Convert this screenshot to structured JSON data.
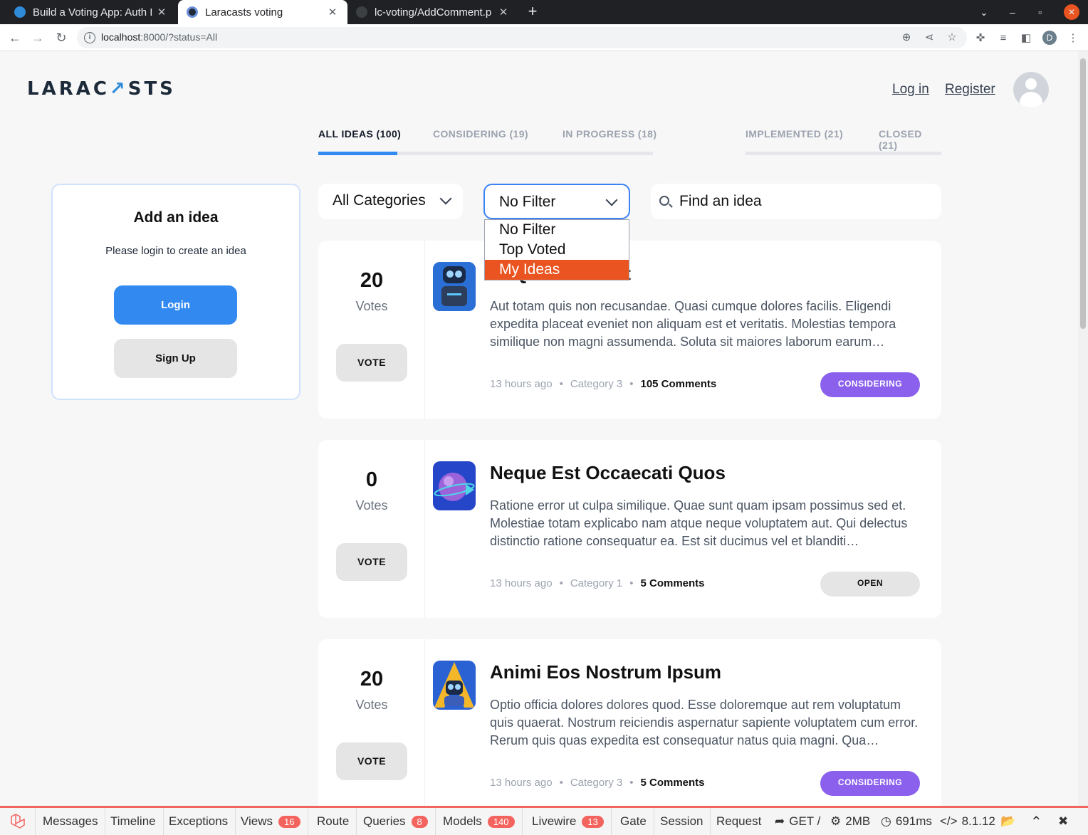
{
  "browser": {
    "tabs": [
      {
        "title": "Build a Voting App: Auth I",
        "active": false
      },
      {
        "title": "Laracasts voting",
        "active": true
      },
      {
        "title": "lc-voting/AddComment.p",
        "active": false
      }
    ],
    "new_tab": "+",
    "url_host": "localhost",
    "url_rest": ":8000/?status=All",
    "profile_initial": "D"
  },
  "header": {
    "logo_left": "LARAC",
    "logo_accent": "↗",
    "logo_right": "STS",
    "login_link": "Log in",
    "register_link": "Register"
  },
  "status_tabs": [
    {
      "label": "ALL IDEAS (100)",
      "active": true
    },
    {
      "label": "CONSIDERING (19)",
      "active": false
    },
    {
      "label": "IN PROGRESS (18)",
      "active": false
    },
    {
      "label": "IMPLEMENTED (21)",
      "active": false
    },
    {
      "label": "CLOSED (21)",
      "active": false
    }
  ],
  "sidebar": {
    "title": "Add an idea",
    "subtitle": "Please login to create an idea",
    "login_button": "Login",
    "signup_button": "Sign Up"
  },
  "filters": {
    "category": "All Categories",
    "other": "No Filter",
    "search_placeholder": "Find an idea",
    "dropdown_options": [
      "No Filter",
      "Top Voted",
      "My Ideas"
    ],
    "highlighted_option": "My Ideas"
  },
  "ideas": [
    {
      "votes": "20",
      "votes_label": "Votes",
      "vote_button": "VOTE",
      "title": "Et Quo Sunt Est",
      "description": "Aut totam quis non recusandae. Quasi cumque dolores facilis. Eligendi expedita placeat eveniet non aliquam est et veritatis. Molestias tempora similique non magni assumenda. Soluta sit maiores laborum earum…",
      "time": "13 hours ago",
      "category": "Category 3",
      "comments": "105 Comments",
      "status": "CONSIDERING",
      "icon": "robot-avatar-icon"
    },
    {
      "votes": "0",
      "votes_label": "Votes",
      "vote_button": "VOTE",
      "title": "Neque Est Occaecati Quos",
      "description": "Ratione error ut culpa similique. Quae sunt quam ipsam possimus sed et. Molestiae totam explicabo nam atque neque voluptatem aut. Qui delectus distinctio ratione consequatur ea. Est sit ducimus vel et blanditi…",
      "time": "13 hours ago",
      "category": "Category 1",
      "comments": "5 Comments",
      "status": "OPEN",
      "icon": "planet-avatar-icon"
    },
    {
      "votes": "20",
      "votes_label": "Votes",
      "vote_button": "VOTE",
      "title": "Animi Eos Nostrum Ipsum",
      "description": "Optio officia dolores dolores quod. Esse doloremque aut rem voluptatum quis quaerat. Nostrum reiciendis aspernatur sapiente voluptatem cum error. Rerum quis quas expedita est consequatur natus quia magni. Qua…",
      "time": "13 hours ago",
      "category": "Category 3",
      "comments": "5 Comments",
      "status": "CONSIDERING",
      "icon": "robot-a-avatar-icon"
    }
  ],
  "debugbar": {
    "items": [
      {
        "label": "Messages"
      },
      {
        "label": "Timeline"
      },
      {
        "label": "Exceptions"
      },
      {
        "label": "Views",
        "badge": "16"
      },
      {
        "label": "Route"
      },
      {
        "label": "Queries",
        "badge": "8"
      },
      {
        "label": "Models",
        "badge": "140"
      },
      {
        "label": "Livewire",
        "badge": "13"
      },
      {
        "label": "Gate"
      },
      {
        "label": "Session"
      },
      {
        "label": "Request"
      }
    ],
    "method": "GET /",
    "memory": "2MB",
    "time": "691ms",
    "php": "8.1.12"
  },
  "colors": {
    "accent_blue": "#328af1",
    "considering": "#8b60ed",
    "highlight_orange": "#e95420",
    "debug_red": "#f4645f"
  }
}
